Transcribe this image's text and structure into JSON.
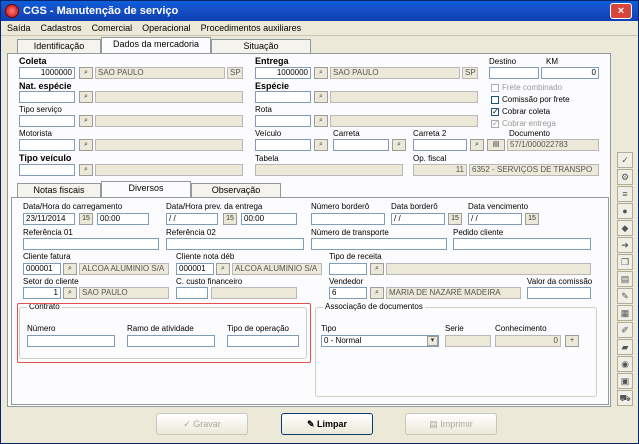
{
  "window": {
    "title": "CGS - Manutenção de serviço",
    "close": "×"
  },
  "menu": [
    "Saída",
    "Cadastros",
    "Comercial",
    "Operacional",
    "Procedimentos auxiliares"
  ],
  "top_tabs": [
    "Identificação",
    "Dados da mercadoria",
    "Situação"
  ],
  "coleta": {
    "label": "Coleta",
    "code": "1000000",
    "city": "SAO PAULO",
    "uf": "SP"
  },
  "entrega": {
    "label": "Entrega",
    "code": "1000000",
    "city": "SAO PAULO",
    "uf": "SP"
  },
  "destino": {
    "label": "Destino",
    "km_label": "KM",
    "km": "0"
  },
  "nat_especie": {
    "label": "Nat. espécie"
  },
  "especie": {
    "label": "Espécie"
  },
  "checks": [
    {
      "label": "Frete combinado",
      "checked": false,
      "disabled": true
    },
    {
      "label": "Comissão por frete",
      "checked": false,
      "disabled": false
    },
    {
      "label": "Cobrar coleta",
      "checked": true,
      "disabled": false
    },
    {
      "label": "Cobrar entrega",
      "checked": true,
      "disabled": true
    }
  ],
  "tipo_servico": {
    "label": "Tipo serviço"
  },
  "rota": {
    "label": "Rota"
  },
  "motorista": {
    "label": "Motorista"
  },
  "veiculo": {
    "label": "Veículo"
  },
  "carreta": {
    "label": "Carreta"
  },
  "carreta2": {
    "label": "Carreta 2"
  },
  "documento": {
    "label": "Documento",
    "value": "57/1/000022783"
  },
  "tipo_veiculo": {
    "label": "Tipo veículo"
  },
  "tabela": {
    "label": "Tabela"
  },
  "op_fiscal": {
    "label": "Op. fiscal",
    "code": "11",
    "desc": "6352 - SERVIÇOS DE TRANSPO"
  },
  "sub_tabs": [
    "Notas fiscais",
    "Diversos",
    "Observação"
  ],
  "diversos": {
    "dh_carregamento": {
      "label": "Data/Hora do carregamento",
      "date": "23/11/2014",
      "time": "00:00"
    },
    "dh_entrega": {
      "label": "Data/Hora prev. da entrega",
      "date": " / /",
      "time": "00:00"
    },
    "numero_bordero": {
      "label": "Número borderô"
    },
    "data_bordero": {
      "label": "Data borderô",
      "date": " / /"
    },
    "data_vencimento": {
      "label": "Data vencimento",
      "date": " / /"
    },
    "ref1": {
      "label": "Referência 01"
    },
    "ref2": {
      "label": "Referência 02"
    },
    "num_transporte": {
      "label": "Número de transporte"
    },
    "pedido_cliente": {
      "label": "Pedido cliente"
    },
    "cliente_fatura": {
      "label": "Cliente fatura",
      "code": "000001",
      "name": "ALCOA ALUMINIO S/A"
    },
    "cliente_nota": {
      "label": "Cliente nota déb",
      "code": "000001",
      "name": "ALCOA ALUMINIO S/A"
    },
    "tipo_receita": {
      "label": "Tipo de receita"
    },
    "setor_cliente": {
      "label": "Setor do cliente",
      "code": "1",
      "city": "SAO PAULO"
    },
    "c_custo": {
      "label": "C. custo financeiro"
    },
    "vendedor": {
      "label": "Vendedor",
      "code": "6",
      "name": "MARIA DE NAZARÉ MADEIRA"
    },
    "valor_comissao": {
      "label": "Valor da comissão"
    }
  },
  "contrato": {
    "title": "Contrato",
    "numero": "Número",
    "ramo": "Ramo de atividade",
    "tipo_op": "Tipo de operação"
  },
  "assoc": {
    "title": "Associação de documentos",
    "tipo_label": "Tipo",
    "tipo_value": "0 - Normal",
    "serie_label": "Serie",
    "conhecimento_label": "Conhecimento",
    "conhecimento_value": "0"
  },
  "buttons": {
    "gravar": "Gravar",
    "limpar": "Limpar",
    "imprimir": "Imprimir"
  },
  "icons": {
    "search": "binoculars-icon",
    "calendar": "calendar-icon"
  }
}
